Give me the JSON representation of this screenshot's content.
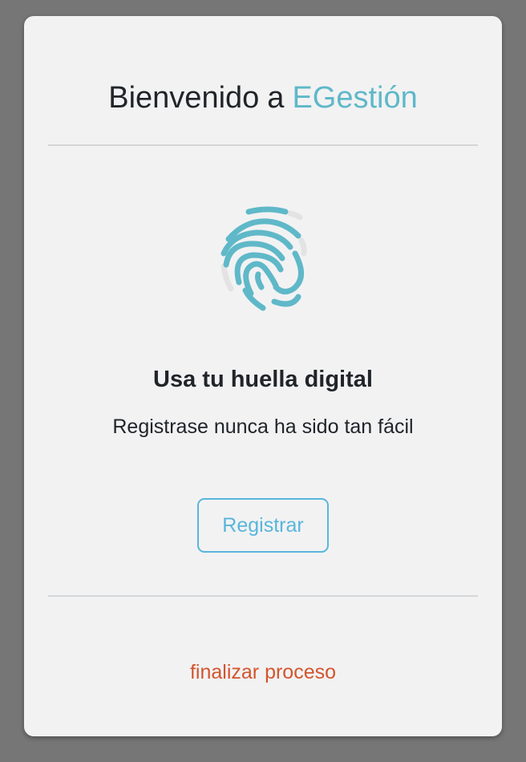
{
  "header": {
    "title_prefix": "Bienvenido",
    "title_connector": "a",
    "brand_name": "EGestión"
  },
  "content": {
    "icon": "fingerprint-icon",
    "heading": "Usa tu huella digital",
    "tagline": "Registrase nunca ha sido tan fácil",
    "register_label": "Registrar"
  },
  "footer": {
    "finish_link": "finalizar proceso"
  },
  "colors": {
    "background": "#767676",
    "card": "#f2f2f3",
    "brand": "#5fb8c8",
    "button_accent": "#59b6db",
    "link": "#d2552d",
    "fingerprint_muted": "#e3e3e3"
  }
}
